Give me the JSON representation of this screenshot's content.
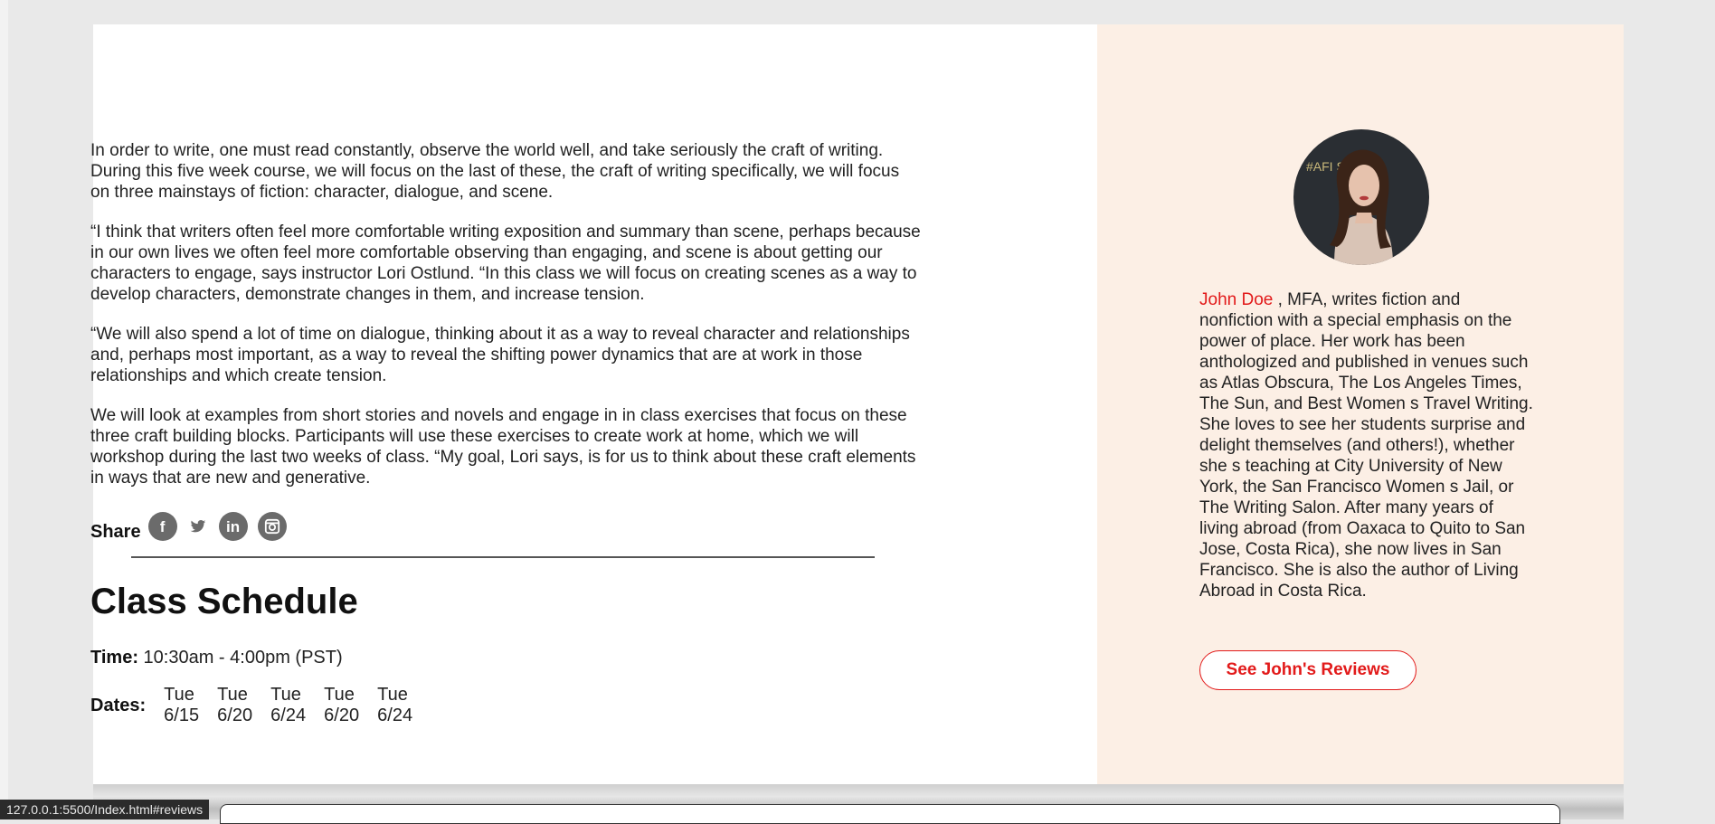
{
  "content": {
    "paragraphs": [
      "In order to write, one must read constantly, observe the world well, and take seriously the craft of writing. During this five week course, we will focus on the last of these, the craft of writing specifically, we will focus on three mainstays of fiction: character, dialogue, and scene.",
      "“I think that writers often feel more comfortable writing exposition and summary than scene, perhaps because in our own lives we often feel more comfortable observing than engaging, and scene is about getting our characters to engage, says instructor Lori Ostlund. “In this class we will focus on creating scenes as a way to develop characters, demonstrate changes in them, and increase tension.",
      "“We will also spend a lot of time on dialogue, thinking about it as a way to reveal character and relationships and, perhaps most important, as a way to reveal the shifting power dynamics that are at work in those relationships and which create tension.",
      "We will look at examples from short stories and novels and engage in in class exercises that focus on these three craft building blocks. Participants will use these exercises to create work at home, which we will workshop during the last two weeks of class. “My goal, Lori says, is for us to think about these craft elements in ways that are new and generative."
    ],
    "share_label": "Share",
    "share_icons": {
      "facebook": "f",
      "twitter": "🐦",
      "linkedin": "in",
      "instagram": "◙"
    }
  },
  "schedule": {
    "title": "Class Schedule",
    "time_label": "Time:",
    "time_value": "10:30am - 4:00pm (PST)",
    "dates_label": "Dates:",
    "dates": [
      {
        "day": "Tue",
        "date": "6/15"
      },
      {
        "day": "Tue",
        "date": "6/20"
      },
      {
        "day": "Tue",
        "date": "6/24"
      },
      {
        "day": "Tue",
        "date": "6/20"
      },
      {
        "day": "Tue",
        "date": "6/24"
      }
    ]
  },
  "instructor": {
    "name": "John Doe",
    "bio": " , MFA, writes fiction and nonfiction with a special emphasis on the power of place. Her work has been anthologized and published in venues such as Atlas Obscura, The Los Angeles Times, The Sun, and Best Women s Travel Writing. She loves to see her students surprise and delight themselves (and others!), whether she s teaching at City University of New York, the San Francisco Women s Jail, or The Writing Salon. After many years of living abroad (from Oaxaca to Quito to San Jose, Costa Rica), she now lives in San Francisco. She is also the author of Living Abroad in Costa Rica.",
    "avatar_backdrop_text": "#AFI   S",
    "reviews_button": "See John's Reviews"
  },
  "status_bar": {
    "url": "127.0.0.1:5500/Index.html#reviews"
  },
  "colors": {
    "accent": "#e21a1a",
    "sidebar_bg": "#fcefe5",
    "page_bg": "#e9e9e9",
    "icon_gray": "#6b6b6b"
  }
}
